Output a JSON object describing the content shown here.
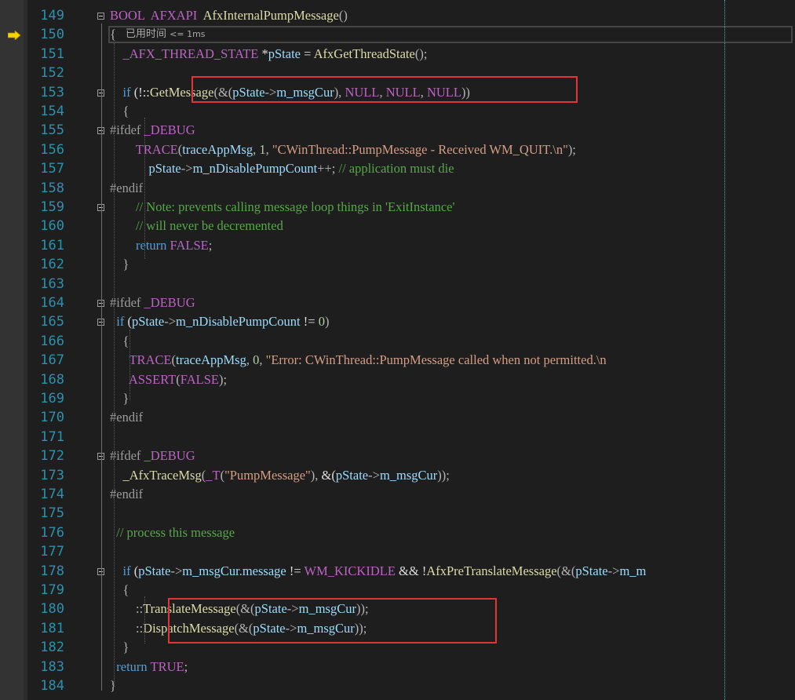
{
  "editor": {
    "perf_tip": {
      "text": "已用时间",
      "suffix": "<= 1ms"
    },
    "lines": [
      {
        "num": "149",
        "tokens": [
          [
            "mac",
            "BOOL"
          ],
          [
            "",
            "  "
          ],
          [
            "mac",
            "AFXAPI"
          ],
          [
            "",
            "  "
          ],
          [
            "fn",
            "AfxInternalPumpMessage"
          ],
          [
            "op",
            "()"
          ]
        ]
      },
      {
        "num": "150",
        "tokens": [
          [
            "op",
            "{"
          ]
        ]
      },
      {
        "num": "151",
        "tokens": [
          [
            "",
            "    "
          ],
          [
            "mac",
            "_AFX_THREAD_STATE"
          ],
          [
            "",
            " *"
          ],
          [
            "var",
            "pState"
          ],
          [
            "",
            " = "
          ],
          [
            "fn",
            "AfxGetThreadState"
          ],
          [
            "op",
            "();"
          ]
        ]
      },
      {
        "num": "152",
        "tokens": []
      },
      {
        "num": "153",
        "tokens": [
          [
            "",
            "    "
          ],
          [
            "kw",
            "if"
          ],
          [
            "",
            " (!::"
          ],
          [
            "fn",
            "GetMessage"
          ],
          [
            "op",
            "(&("
          ],
          [
            "var",
            "pState"
          ],
          [
            "op",
            "->"
          ],
          [
            "var",
            "m_msgCur"
          ],
          [
            "op",
            "),"
          ],
          [
            "",
            " "
          ],
          [
            "mac",
            "NULL"
          ],
          [
            "op",
            ","
          ],
          [
            "",
            " "
          ],
          [
            "mac",
            "NULL"
          ],
          [
            "op",
            ","
          ],
          [
            "",
            " "
          ],
          [
            "mac",
            "NULL"
          ],
          [
            "op",
            "))"
          ]
        ]
      },
      {
        "num": "154",
        "tokens": [
          [
            "",
            "    "
          ],
          [
            "op",
            "{"
          ]
        ]
      },
      {
        "num": "155",
        "tokens": [
          [
            "pp",
            "#ifdef"
          ],
          [
            "",
            " "
          ],
          [
            "mac",
            "_DEBUG"
          ]
        ]
      },
      {
        "num": "156",
        "tokens": [
          [
            "",
            "        "
          ],
          [
            "mac",
            "TRACE"
          ],
          [
            "op",
            "("
          ],
          [
            "var",
            "traceAppMsg"
          ],
          [
            "op",
            ","
          ],
          [
            "",
            " "
          ],
          [
            "num",
            "1"
          ],
          [
            "op",
            ","
          ],
          [
            "",
            " "
          ],
          [
            "str",
            "\"CWinThread::PumpMessage - Received WM_QUIT.\\n\""
          ],
          [
            "op",
            ");"
          ]
        ]
      },
      {
        "num": "157",
        "tokens": [
          [
            "",
            "            "
          ],
          [
            "var",
            "pState"
          ],
          [
            "op",
            "->"
          ],
          [
            "var",
            "m_nDisablePumpCount"
          ],
          [
            "op",
            "++;"
          ],
          [
            "",
            " "
          ],
          [
            "cmt",
            "// application must die"
          ]
        ]
      },
      {
        "num": "158",
        "tokens": [
          [
            "pp",
            "#endif"
          ]
        ]
      },
      {
        "num": "159",
        "tokens": [
          [
            "",
            "        "
          ],
          [
            "cmt",
            "// Note: prevents calling message loop things in 'ExitInstance'"
          ]
        ]
      },
      {
        "num": "160",
        "tokens": [
          [
            "",
            "        "
          ],
          [
            "cmt",
            "// will never be decremented"
          ]
        ]
      },
      {
        "num": "161",
        "tokens": [
          [
            "",
            "        "
          ],
          [
            "kw",
            "return"
          ],
          [
            "",
            " "
          ],
          [
            "mac",
            "FALSE"
          ],
          [
            "op",
            ";"
          ]
        ]
      },
      {
        "num": "162",
        "tokens": [
          [
            "",
            "    "
          ],
          [
            "op",
            "}"
          ]
        ]
      },
      {
        "num": "163",
        "tokens": []
      },
      {
        "num": "164",
        "tokens": [
          [
            "pp",
            "#ifdef"
          ],
          [
            "",
            " "
          ],
          [
            "mac",
            "_DEBUG"
          ]
        ]
      },
      {
        "num": "165",
        "tokens": [
          [
            "",
            "  "
          ],
          [
            "kw",
            "if"
          ],
          [
            "",
            " ("
          ],
          [
            "var",
            "pState"
          ],
          [
            "op",
            "->"
          ],
          [
            "var",
            "m_nDisablePumpCount"
          ],
          [
            "",
            " != "
          ],
          [
            "num",
            "0"
          ],
          [
            "op",
            ")"
          ]
        ]
      },
      {
        "num": "166",
        "tokens": [
          [
            "",
            "    "
          ],
          [
            "op",
            "{"
          ]
        ]
      },
      {
        "num": "167",
        "tokens": [
          [
            "",
            "      "
          ],
          [
            "mac",
            "TRACE"
          ],
          [
            "op",
            "("
          ],
          [
            "var",
            "traceAppMsg"
          ],
          [
            "op",
            ","
          ],
          [
            "",
            " "
          ],
          [
            "num",
            "0"
          ],
          [
            "op",
            ","
          ],
          [
            "",
            " "
          ],
          [
            "str",
            "\"Error: CWinThread::PumpMessage called when not permitted.\\n"
          ]
        ]
      },
      {
        "num": "168",
        "tokens": [
          [
            "",
            "      "
          ],
          [
            "mac",
            "ASSERT"
          ],
          [
            "op",
            "("
          ],
          [
            "mac",
            "FALSE"
          ],
          [
            "op",
            ");"
          ]
        ]
      },
      {
        "num": "169",
        "tokens": [
          [
            "",
            "    "
          ],
          [
            "op",
            "}"
          ]
        ]
      },
      {
        "num": "170",
        "tokens": [
          [
            "pp",
            "#endif"
          ]
        ]
      },
      {
        "num": "171",
        "tokens": []
      },
      {
        "num": "172",
        "tokens": [
          [
            "pp",
            "#ifdef"
          ],
          [
            "",
            " "
          ],
          [
            "mac",
            "_DEBUG"
          ]
        ]
      },
      {
        "num": "173",
        "tokens": [
          [
            "",
            "    "
          ],
          [
            "fn",
            "_AfxTraceMsg"
          ],
          [
            "op",
            "("
          ],
          [
            "mac",
            "_T"
          ],
          [
            "op",
            "("
          ],
          [
            "str",
            "\"PumpMessage\""
          ],
          [
            "op",
            "),"
          ],
          [
            "",
            " &("
          ],
          [
            "var",
            "pState"
          ],
          [
            "op",
            "->"
          ],
          [
            "var",
            "m_msgCur"
          ],
          [
            "op",
            "));"
          ]
        ]
      },
      {
        "num": "174",
        "tokens": [
          [
            "pp",
            "#endif"
          ]
        ]
      },
      {
        "num": "175",
        "tokens": []
      },
      {
        "num": "176",
        "tokens": [
          [
            "",
            "  "
          ],
          [
            "cmt",
            "// process this message"
          ]
        ]
      },
      {
        "num": "177",
        "tokens": []
      },
      {
        "num": "178",
        "tokens": [
          [
            "",
            "    "
          ],
          [
            "kw",
            "if"
          ],
          [
            "",
            " ("
          ],
          [
            "var",
            "pState"
          ],
          [
            "op",
            "->"
          ],
          [
            "var",
            "m_msgCur"
          ],
          [
            "op",
            "."
          ],
          [
            "var",
            "message"
          ],
          [
            "",
            " != "
          ],
          [
            "mac",
            "WM_KICKIDLE"
          ],
          [
            "",
            " && !"
          ],
          [
            "fn",
            "AfxPreTranslateMessage"
          ],
          [
            "op",
            "(&("
          ],
          [
            "var",
            "pState"
          ],
          [
            "op",
            "->"
          ],
          [
            "var",
            "m_m"
          ]
        ]
      },
      {
        "num": "179",
        "tokens": [
          [
            "",
            "    "
          ],
          [
            "op",
            "{"
          ]
        ]
      },
      {
        "num": "180",
        "tokens": [
          [
            "",
            "        "
          ],
          [
            "op",
            "::"
          ],
          [
            "fn",
            "TranslateMessage"
          ],
          [
            "op",
            "(&("
          ],
          [
            "var",
            "pState"
          ],
          [
            "op",
            "->"
          ],
          [
            "var",
            "m_msgCur"
          ],
          [
            "op",
            "));"
          ]
        ]
      },
      {
        "num": "181",
        "tokens": [
          [
            "",
            "        "
          ],
          [
            "op",
            "::"
          ],
          [
            "fn",
            "DispatchMessage"
          ],
          [
            "op",
            "(&("
          ],
          [
            "var",
            "pState"
          ],
          [
            "op",
            "->"
          ],
          [
            "var",
            "m_msgCur"
          ],
          [
            "op",
            "));"
          ]
        ]
      },
      {
        "num": "182",
        "tokens": [
          [
            "",
            "    "
          ],
          [
            "op",
            "}"
          ]
        ]
      },
      {
        "num": "183",
        "tokens": [
          [
            "",
            "  "
          ],
          [
            "kw",
            "return"
          ],
          [
            "",
            " "
          ],
          [
            "mac",
            "TRUE"
          ],
          [
            "op",
            ";"
          ]
        ]
      },
      {
        "num": "184",
        "tokens": [
          [
            "op",
            "}"
          ]
        ]
      }
    ]
  }
}
